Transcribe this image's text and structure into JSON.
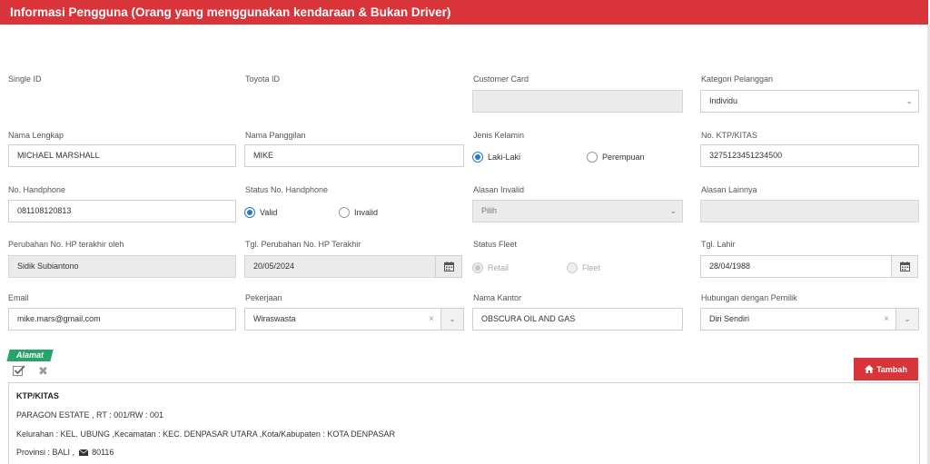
{
  "header": {
    "title": "Informasi Pengguna (Orang yang menggunakan kendaraan & Bukan Driver)"
  },
  "fields": {
    "single_id": {
      "label": "Single ID"
    },
    "toyota_id": {
      "label": "Toyota ID"
    },
    "customer_card": {
      "label": "Customer Card",
      "value": ""
    },
    "kategori_pelanggan": {
      "label": "Kategori Pelanggan",
      "value": "Individu"
    },
    "nama_lengkap": {
      "label": "Nama Lengkap",
      "value": "MICHAEL MARSHALL"
    },
    "nama_panggilan": {
      "label": "Nama Panggilan",
      "value": "MIKE"
    },
    "jenis_kelamin": {
      "label": "Jenis Kelamin",
      "options": [
        "Laki-Laki",
        "Perempuan"
      ],
      "selected": "Laki-Laki"
    },
    "no_ktp": {
      "label": "No. KTP/KITAS",
      "value": "3275123451234500"
    },
    "no_handphone": {
      "label": "No. Handphone",
      "value": "081108120813"
    },
    "status_handphone": {
      "label": "Status No. Handphone",
      "options": [
        "Valid",
        "Invalid"
      ],
      "selected": "Valid"
    },
    "alasan_invalid": {
      "label": "Alasan Invalid",
      "placeholder": "Pilih"
    },
    "alasan_lainnya": {
      "label": "Alasan Lainnya",
      "value": ""
    },
    "perubahan_hp_oleh": {
      "label": "Perubahan No. HP terakhir oleh",
      "value": "Sidik Subiantono"
    },
    "tgl_perubahan_hp": {
      "label": "Tgl. Perubahan No. HP Terakhir",
      "value": "20/05/2024"
    },
    "status_fleet": {
      "label": "Status Fleet",
      "options": [
        "Retail",
        "Fleet"
      ],
      "selected": "Retail"
    },
    "tgl_lahir": {
      "label": "Tgl. Lahir",
      "value": "28/04/1988"
    },
    "email": {
      "label": "Email",
      "value": "mike.mars@gmail.com"
    },
    "pekerjaan": {
      "label": "Pekerjaan",
      "value": "Wiraswasta"
    },
    "nama_kantor": {
      "label": "Nama Kantor",
      "value": "OBSCURA OIL AND GAS"
    },
    "hubungan_pemilik": {
      "label": "Hubungan dengan Pemilik",
      "value": "Diri Sendiri"
    }
  },
  "address_section": {
    "tag": "Alamat",
    "add_button": "Tambah",
    "entry": {
      "type": "KTP/KITAS",
      "street": "PARAGON ESTATE , RT : 001/RW : 001",
      "region": "Kelurahan : KEL. UBUNG ,Kecamatan : KEC. DENPASAR UTARA ,Kota/Kabupaten : KOTA DENPASAR",
      "province": "Provinsi : BALI ,",
      "postal_code": "80116"
    }
  },
  "colors": {
    "brand_red": "#d9343a",
    "tag_green": "#27a566",
    "radio_blue": "#2a7ac7"
  }
}
